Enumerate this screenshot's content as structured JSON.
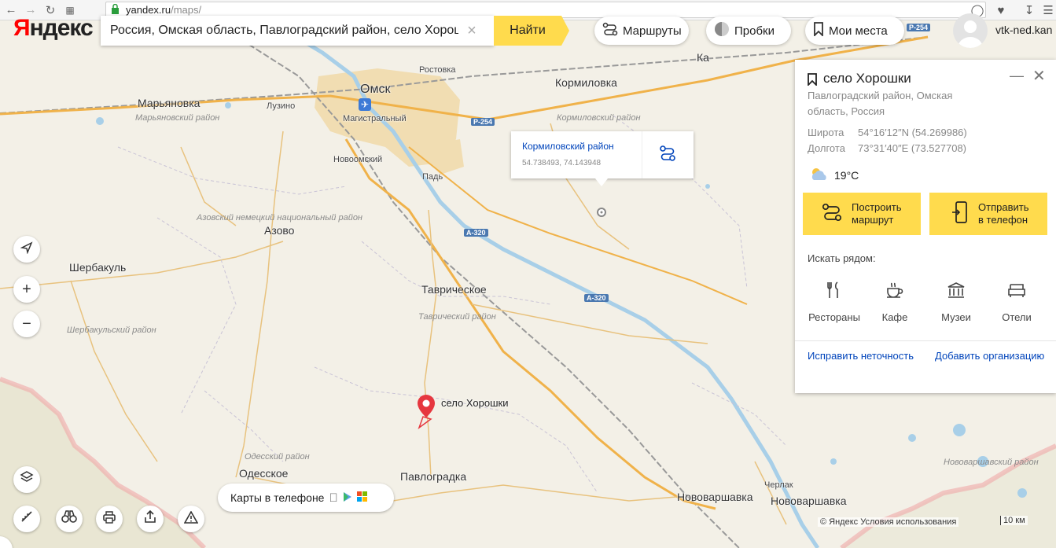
{
  "browser": {
    "url_host": "yandex.ru",
    "url_path": "/maps/"
  },
  "logo": {
    "first_letter": "Я",
    "rest": "ндекс"
  },
  "search": {
    "query": "Россия, Омская область, Павлоградский район, село Хорошки",
    "button_label": "Найти"
  },
  "toolbar": {
    "routes_label": "Маршруты",
    "traffic_label": "Пробки",
    "places_label": "Мои места",
    "username": "vtk-ned.kan"
  },
  "card": {
    "title": "село Хорошки",
    "address": "Павлоградский район, Омская область, Россия",
    "lat_label": "Широта",
    "lat_value": "54°16′12″N (54.269986)",
    "lon_label": "Долгота",
    "lon_value": "73°31′40″E (73.527708)",
    "temperature": "19°C",
    "route_button": "Построить маршрут",
    "send_button": "Отправить в телефон",
    "nearby_label": "Искать рядом:",
    "nearby": [
      "Рестораны",
      "Кафе",
      "Музеи",
      "Отели"
    ],
    "fix_link": "Исправить неточность",
    "add_org_link": "Добавить организацию"
  },
  "popup": {
    "title": "Кормиловский район",
    "coords": "54.738493, 74.143948"
  },
  "pin_label": "село Хорошки",
  "map_labels": {
    "cities": [
      "Омск",
      "Кормиловка",
      "Марьяновка",
      "Лузино",
      "Магистральный",
      "Ростовка",
      "Новоомский",
      "Падь",
      "Азово",
      "Шербакуль",
      "Таврическое",
      "Одесское",
      "Павлоградка",
      "Нововаршавка",
      "Черлак",
      "Нововаршавка",
      "Ка"
    ],
    "districts": [
      "Марьяновский район",
      "Кормиловский район",
      "Азовский немецкий национальный район",
      "Таврический район",
      "Шербакульский район",
      "Одесский район",
      "Нововаршавский район"
    ],
    "roads": [
      "Р-254",
      "Р-254",
      "А-320",
      "А-320"
    ]
  },
  "phone_bar": {
    "label": "Карты в телефоне"
  },
  "footer": {
    "copyright": "© Яндекс Условия использования",
    "scale": "10 км"
  }
}
